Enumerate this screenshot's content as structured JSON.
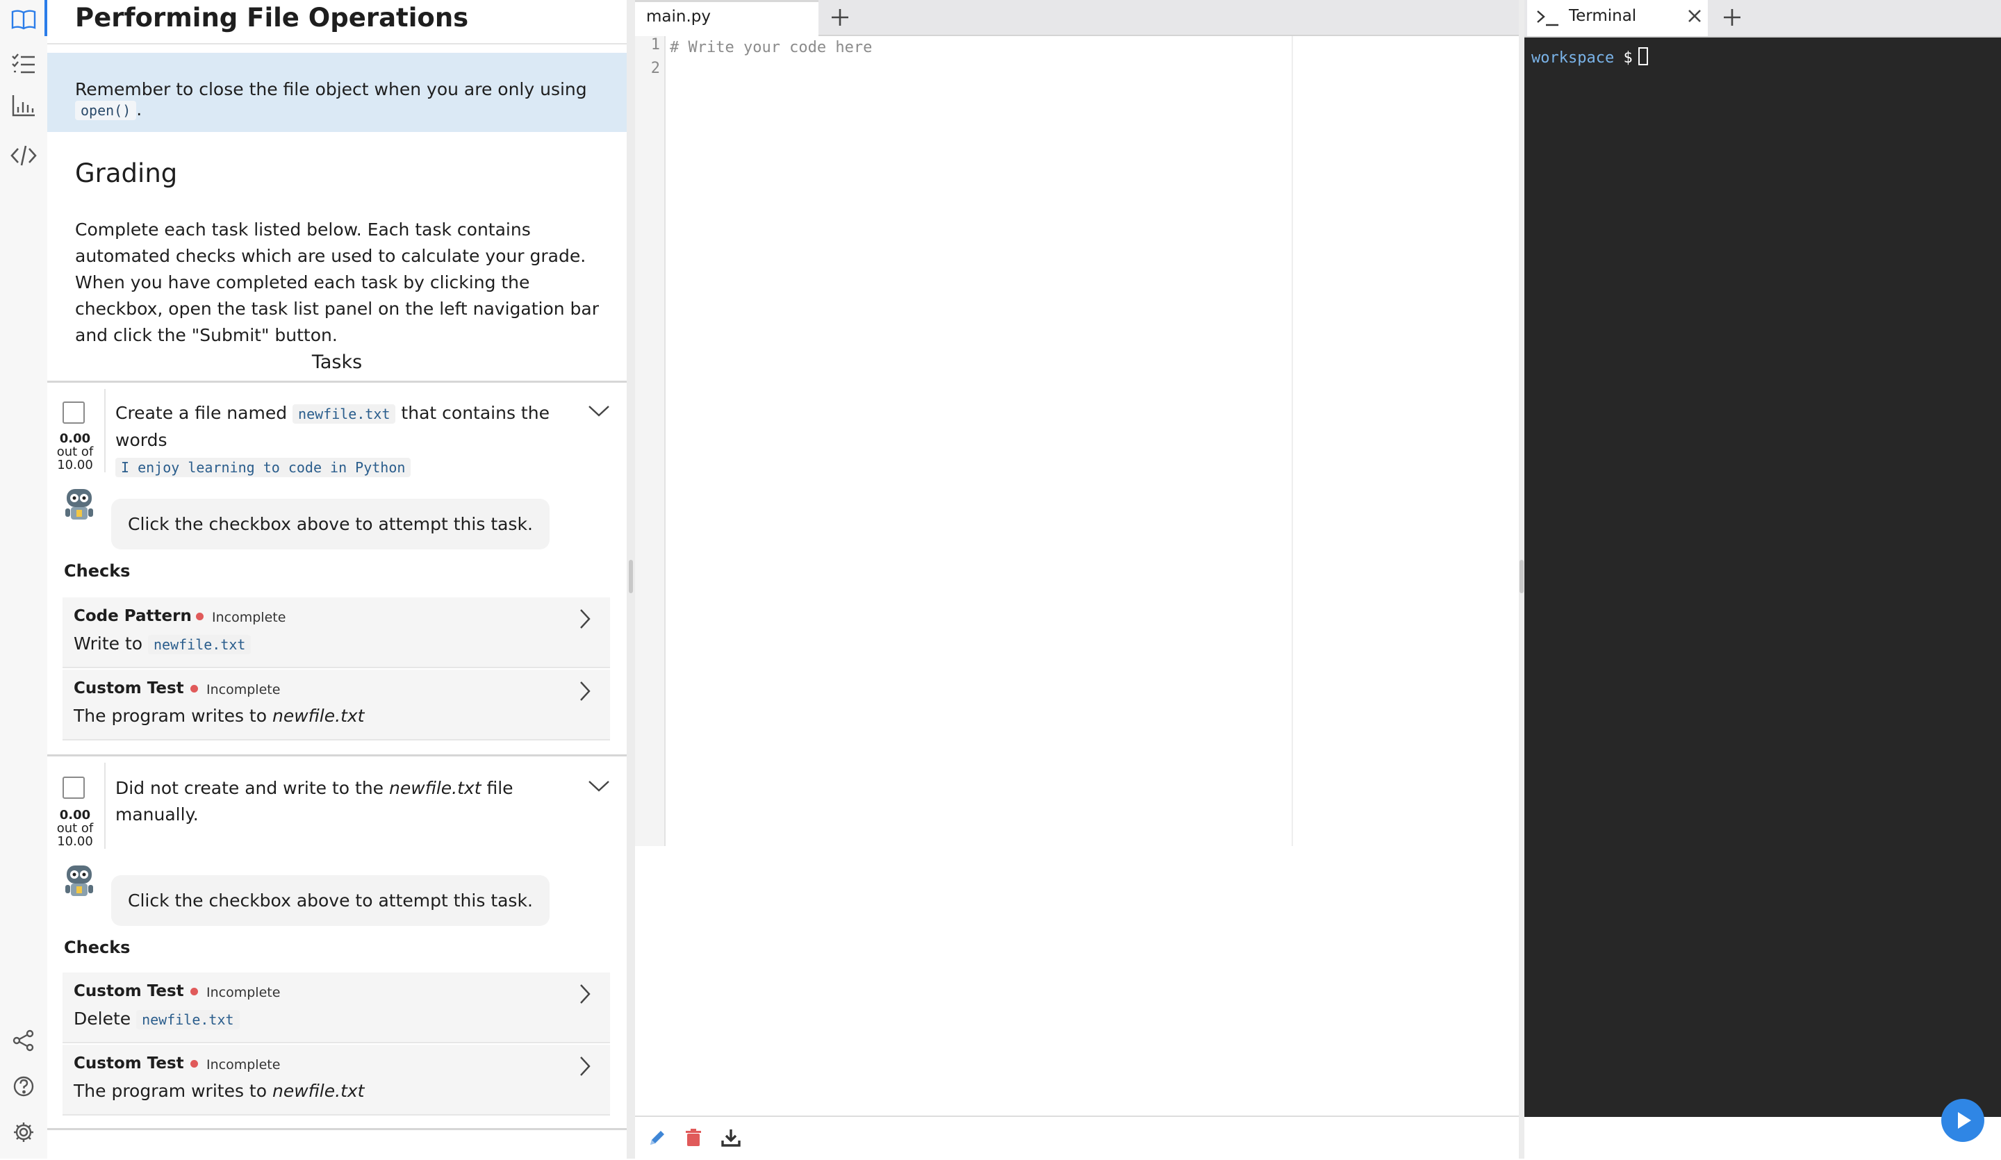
{
  "rail": {
    "items": [
      "guide",
      "task-list",
      "grades",
      "code"
    ],
    "bottom": [
      "share",
      "help",
      "settings"
    ]
  },
  "guide": {
    "title": "Performing File Operations",
    "callout": {
      "text_before": "Remember to close the file object when you are only using ",
      "code": "open()",
      "text_after": "."
    },
    "grading_heading": "Grading",
    "grading_text": "Complete each task listed below. Each task contains automated checks which are used to calculate your grade. When you have completed each task by clicking the checkbox, open the task list panel on the left navigation bar and click the \"Submit\" button.",
    "tasks_heading": "Tasks",
    "tasks": [
      {
        "score": "0.00",
        "out_of": "out of",
        "max": "10.00",
        "text_1": "Create a file named ",
        "code_1": "newfile.txt",
        "text_2": " that contains the words",
        "code_2": "I enjoy learning to code in Python",
        "bubble": "Click the checkbox above to attempt this task.",
        "checks_heading": "Checks",
        "checks": [
          {
            "kind": "Code Pattern",
            "status": "Incomplete",
            "desc": "Write to ",
            "desc_code": "newfile.txt",
            "desc_italic": ""
          },
          {
            "kind": "Custom Test",
            "status": "Incomplete",
            "desc": "The program writes to ",
            "desc_code": "",
            "desc_italic": "newfile.txt"
          }
        ]
      },
      {
        "score": "0.00",
        "out_of": "out of",
        "max": "10.00",
        "text_1": "Did not create and write to the ",
        "italic": "newfile.txt",
        "text_2": " file manually.",
        "bubble": "Click the checkbox above to attempt this task.",
        "checks_heading": "Checks",
        "checks": [
          {
            "kind": "Custom Test",
            "status": "Incomplete",
            "desc": "Delete ",
            "desc_code": "newfile.txt",
            "desc_italic": ""
          },
          {
            "kind": "Custom Test",
            "status": "Incomplete",
            "desc": "The program writes to ",
            "desc_code": "",
            "desc_italic": "newfile.txt"
          }
        ]
      }
    ]
  },
  "editor": {
    "tab_label": "main.py",
    "line_numbers": [
      "1",
      "2"
    ],
    "code_line_1": "# Write your code here",
    "toolbar": [
      "edit",
      "delete",
      "download"
    ]
  },
  "terminal": {
    "tab_label": "Terminal",
    "cwd": "workspace",
    "prompt_symbol": "$"
  },
  "colors": {
    "accent": "#2b7de9",
    "callout_bg": "#dbe9f5",
    "status_incomplete": "#e05a5a",
    "terminal_bg": "#272727",
    "run_button": "#2f86e5"
  }
}
